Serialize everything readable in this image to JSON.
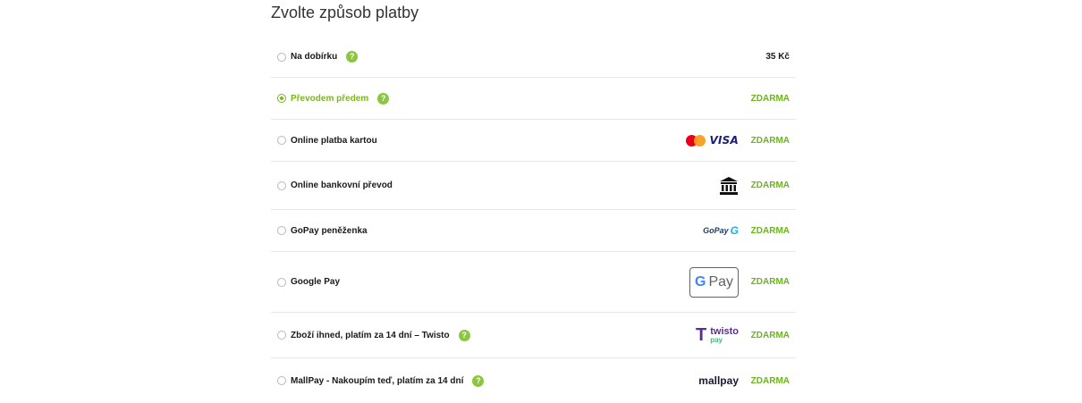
{
  "title": "Zvolte způsob platby",
  "help_glyph": "?",
  "methods": [
    {
      "label": "Na dobírku",
      "price": "35 Kč",
      "selected": false,
      "has_help": true
    },
    {
      "label": "Převodem předem",
      "price": "ZDARMA",
      "selected": true,
      "has_help": true
    },
    {
      "label": "Online platba kartou",
      "price": "ZDARMA",
      "selected": false,
      "has_help": false,
      "logo": "mastercard-visa"
    },
    {
      "label": "Online bankovní převod",
      "price": "ZDARMA",
      "selected": false,
      "has_help": false,
      "logo": "bank-icon"
    },
    {
      "label": "GoPay peněženka",
      "price": "ZDARMA",
      "selected": false,
      "has_help": false,
      "logo": "gopay-logo"
    },
    {
      "label": "Google Pay",
      "price": "ZDARMA",
      "selected": false,
      "has_help": false,
      "logo": "google-pay-logo"
    },
    {
      "label": "Zboží ihned, platím za 14 dní – Twisto",
      "price": "ZDARMA",
      "selected": false,
      "has_help": true,
      "logo": "twisto-pay-logo"
    },
    {
      "label": "MallPay - Nakoupím teď, platím za 14 dní",
      "price": "ZDARMA",
      "selected": false,
      "has_help": true,
      "logo": "mallpay-logo"
    }
  ],
  "logos": {
    "visa": "VISA",
    "gopay": "GoPay",
    "gopay_mark": "G",
    "gpay_g": "G",
    "gpay_text": "Pay",
    "twisto_mark": "T",
    "twisto_word": "twisto",
    "twisto_sub": "pay",
    "mallpay": "mallpay"
  },
  "colors": {
    "accent": "#7ab61f",
    "free_price": "#6cb41e",
    "help_badge": "#8cc63e",
    "divider": "#e8e8e8"
  }
}
